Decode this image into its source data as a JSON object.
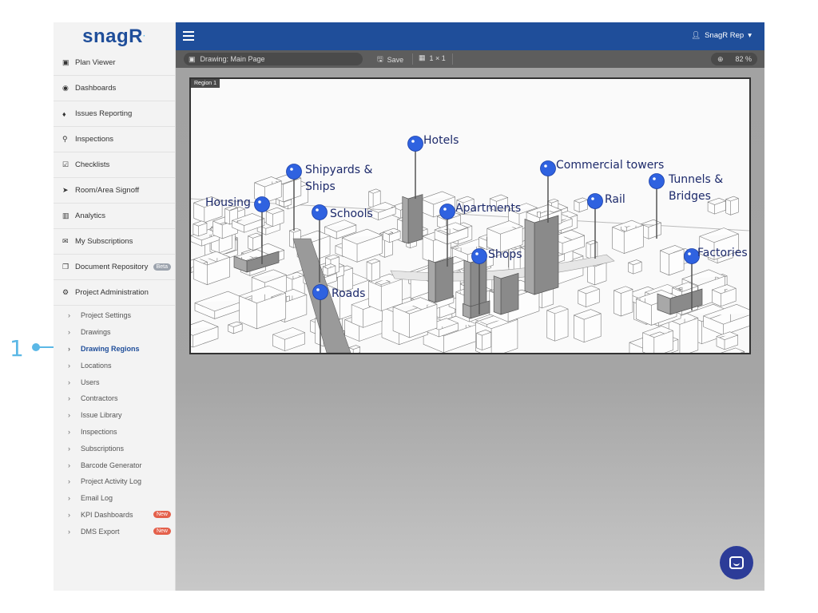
{
  "callout": {
    "number": "1"
  },
  "sidebar": {
    "logo": "snagR",
    "items": [
      {
        "label": "Plan Viewer",
        "icon": "image-icon",
        "glyph": "▣"
      },
      {
        "label": "Dashboards",
        "icon": "dashboard-icon",
        "glyph": "◉"
      },
      {
        "label": "Issues Reporting",
        "icon": "map-marker-icon",
        "glyph": "♦"
      },
      {
        "label": "Inspections",
        "icon": "search-icon",
        "glyph": "⚲"
      },
      {
        "label": "Checklists",
        "icon": "check-square-icon",
        "glyph": "☑"
      },
      {
        "label": "Room/Area Signoff",
        "icon": "location-arrow-icon",
        "glyph": "➤"
      },
      {
        "label": "Analytics",
        "icon": "bar-chart-icon",
        "glyph": "▥"
      },
      {
        "label": "My Subscriptions",
        "icon": "envelope-icon",
        "glyph": "✉"
      },
      {
        "label": "Document Repository",
        "icon": "copy-icon",
        "glyph": "❐",
        "badge": "Beta"
      },
      {
        "label": "Project Administration",
        "icon": "cogs-icon",
        "glyph": "⚙"
      }
    ],
    "sub_items": [
      {
        "label": "Project Settings"
      },
      {
        "label": "Drawings"
      },
      {
        "label": "Drawing Regions",
        "active": true
      },
      {
        "label": "Locations"
      },
      {
        "label": "Users"
      },
      {
        "label": "Contractors"
      },
      {
        "label": "Issue Library"
      },
      {
        "label": "Inspections"
      },
      {
        "label": "Subscriptions"
      },
      {
        "label": "Barcode Generator"
      },
      {
        "label": "Project Activity Log"
      },
      {
        "label": "Email Log"
      },
      {
        "label": "KPI Dashboards",
        "badge": "New"
      },
      {
        "label": "DMS Export",
        "badge": "New"
      }
    ]
  },
  "topbar": {
    "user": "SnagR Rep"
  },
  "toolbar": {
    "drawing_label": "Drawing:  Main Page",
    "save_label": "Save",
    "grid_label": "1 × 1",
    "zoom_value": "82 %"
  },
  "drawing": {
    "region_label": "Region 1",
    "pins": [
      {
        "label": "Housing"
      },
      {
        "label": "Shipyards &",
        "label2": "Ships"
      },
      {
        "label": "Schools"
      },
      {
        "label": "Hotels"
      },
      {
        "label": "Apartments"
      },
      {
        "label": "Shops"
      },
      {
        "label": "Commercial towers"
      },
      {
        "label": "Rail"
      },
      {
        "label": "Tunnels &",
        "label2": "Bridges"
      },
      {
        "label": "Factories"
      },
      {
        "label": "Roads"
      }
    ]
  },
  "colors": {
    "primary": "#1f4e9a",
    "pin": "#2f62e0",
    "accent": "#5bb8e6",
    "badge_new": "#e4604b",
    "chat": "#2c3c98"
  }
}
